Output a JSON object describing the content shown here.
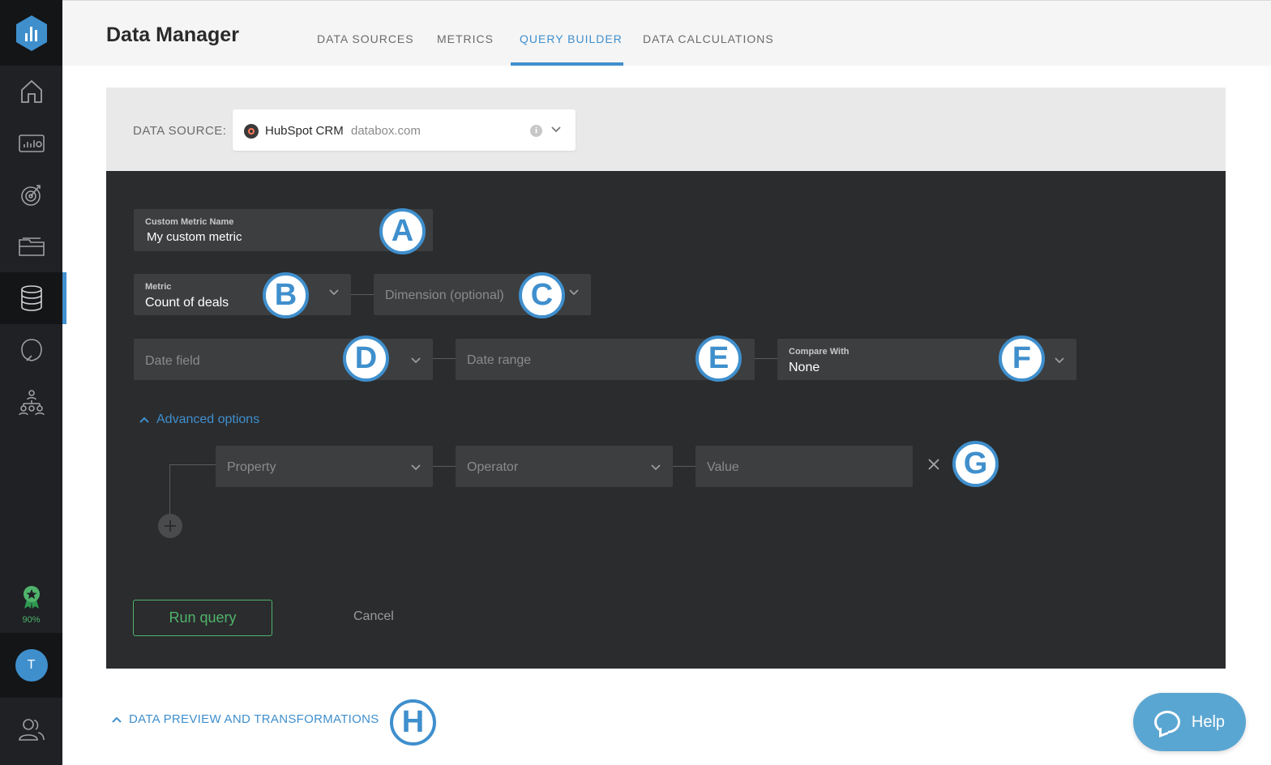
{
  "app": {
    "title": "Data Manager"
  },
  "tabs": [
    {
      "label": "DATA SOURCES"
    },
    {
      "label": "METRICS"
    },
    {
      "label": "QUERY BUILDER"
    },
    {
      "label": "DATA CALCULATIONS"
    }
  ],
  "active_tab": "QUERY BUILDER",
  "sidebar": {
    "items": [
      {
        "icon": "home-icon"
      },
      {
        "icon": "dashboard-icon"
      },
      {
        "icon": "goals-icon"
      },
      {
        "icon": "folder-icon"
      },
      {
        "icon": "database-icon",
        "active": true
      },
      {
        "icon": "alerts-icon"
      },
      {
        "icon": "organization-icon"
      }
    ],
    "badge_percent": "90%",
    "avatar_initial": "T"
  },
  "data_source": {
    "label": "DATA SOURCE:",
    "name": "HubSpot CRM",
    "domain": "databox.com"
  },
  "form": {
    "custom_metric": {
      "label": "Custom Metric Name",
      "value": "My custom metric"
    },
    "metric": {
      "label": "Metric",
      "value": "Count of deals"
    },
    "dimension": {
      "placeholder": "Dimension (optional)"
    },
    "date_field": {
      "placeholder": "Date field"
    },
    "date_range": {
      "placeholder": "Date range"
    },
    "compare_with": {
      "label": "Compare With",
      "value": "None"
    },
    "advanced_options": "Advanced options",
    "filter": {
      "property_placeholder": "Property",
      "operator_placeholder": "Operator",
      "value_placeholder": "Value"
    },
    "run_query": "Run query",
    "cancel": "Cancel"
  },
  "markers": [
    "A",
    "B",
    "C",
    "D",
    "E",
    "F",
    "G",
    "H"
  ],
  "preview_section": "DATA PREVIEW AND TRANSFORMATIONS",
  "help": {
    "label": "Help"
  },
  "colors": {
    "accent": "#3f8fcd",
    "success": "#4fb36b",
    "panel": "#2b2c2e",
    "sidebar": "#1f2125"
  }
}
